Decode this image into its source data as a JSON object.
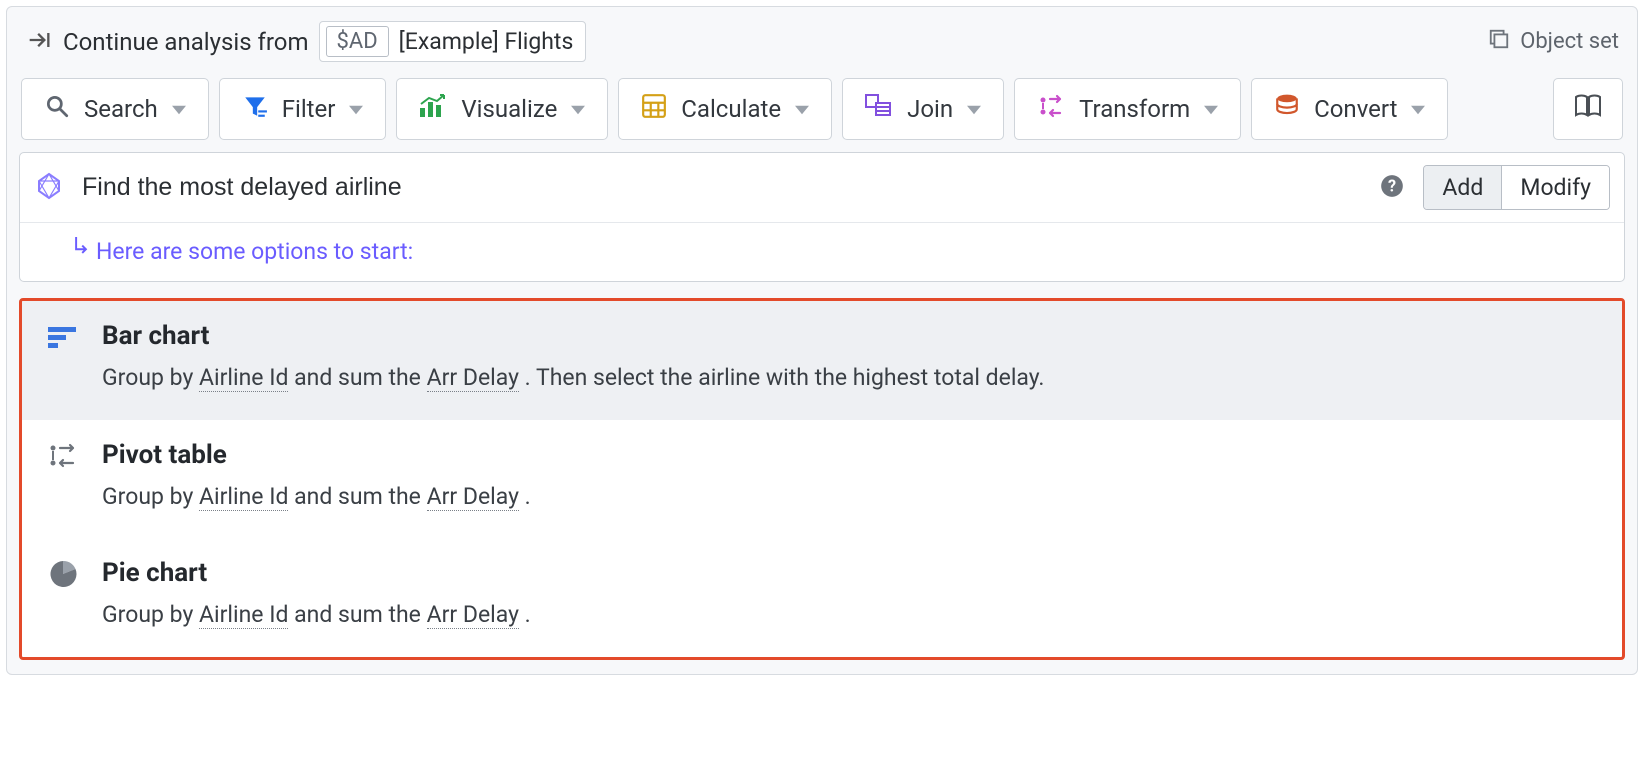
{
  "header": {
    "title": "Continue analysis from",
    "chip_badge": "$AD",
    "chip_label": "[Example] Flights",
    "object_set_label": "Object set"
  },
  "toolbar": {
    "search": "Search",
    "filter": "Filter",
    "visualize": "Visualize",
    "calculate": "Calculate",
    "join": "Join",
    "transform": "Transform",
    "convert": "Convert"
  },
  "query": {
    "value": "Find the most delayed airline",
    "add_label": "Add",
    "modify_label": "Modify",
    "hint": "Here are some options to start:"
  },
  "suggestions": [
    {
      "icon": "bar-chart",
      "title": "Bar chart",
      "desc_parts": [
        "Group by ",
        "Airline Id",
        " and sum the ",
        "Arr Delay",
        " . Then select the airline with the highest total delay."
      ],
      "selected": true
    },
    {
      "icon": "pivot",
      "title": "Pivot table",
      "desc_parts": [
        "Group by ",
        "Airline Id",
        " and sum the ",
        "Arr Delay",
        " ."
      ],
      "selected": false
    },
    {
      "icon": "pie",
      "title": "Pie chart",
      "desc_parts": [
        "Group by ",
        "Airline Id",
        " and sum the ",
        "Arr Delay",
        " ."
      ],
      "selected": false
    }
  ],
  "colors": {
    "search": "#5f6670",
    "filter": "#1f6feb",
    "visualize": "#2da44e",
    "calculate": "#d4a017",
    "join": "#8250df",
    "transform": "#c94fcb",
    "convert": "#d1572c",
    "suggest_bar": "#3a76e0",
    "suggest_pivot": "#6e747c",
    "suggest_pie": "#6e747c",
    "highlight_border": "#e34a2a"
  }
}
